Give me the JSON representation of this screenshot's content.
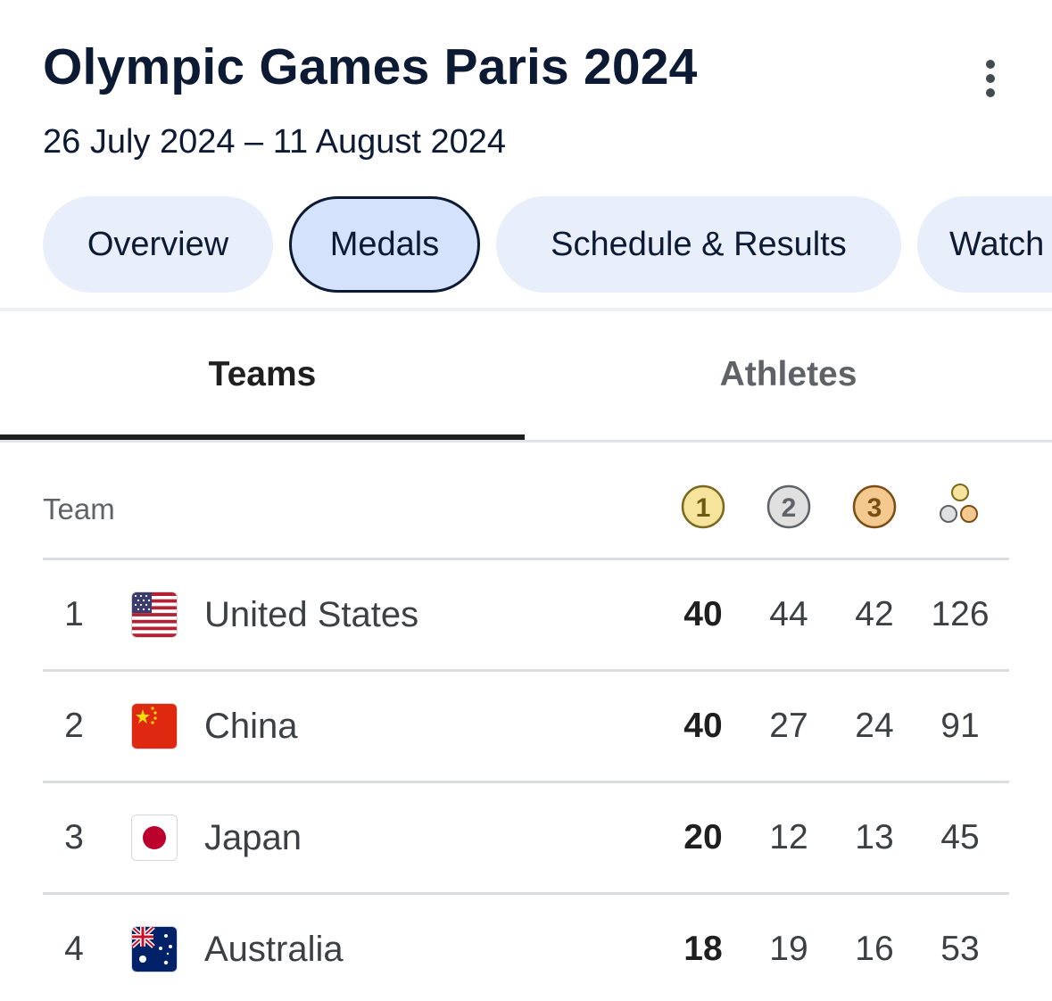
{
  "header": {
    "title": "Olympic Games Paris 2024",
    "dates": "26 July 2024 – 11 August 2024"
  },
  "chips": [
    {
      "label": "Overview",
      "active": false
    },
    {
      "label": "Medals",
      "active": true
    },
    {
      "label": "Schedule & Results",
      "active": false
    },
    {
      "label": "Watch",
      "active": false
    }
  ],
  "tabs": {
    "teams": "Teams",
    "athletes": "Athletes"
  },
  "table": {
    "team_header": "Team",
    "medal_headers": {
      "gold": "1",
      "silver": "2",
      "bronze": "3",
      "total_icon": "medal-total-icon"
    },
    "rows": [
      {
        "rank": "1",
        "country": "United States",
        "flag": "us-flag-icon",
        "gold": "40",
        "silver": "44",
        "bronze": "42",
        "total": "126"
      },
      {
        "rank": "2",
        "country": "China",
        "flag": "china-flag-icon",
        "gold": "40",
        "silver": "27",
        "bronze": "24",
        "total": "91"
      },
      {
        "rank": "3",
        "country": "Japan",
        "flag": "japan-flag-icon",
        "gold": "20",
        "silver": "12",
        "bronze": "13",
        "total": "45"
      },
      {
        "rank": "4",
        "country": "Australia",
        "flag": "australia-flag-icon",
        "gold": "18",
        "silver": "19",
        "bronze": "16",
        "total": "53"
      }
    ]
  },
  "colors": {
    "gold_medal": "#f6e39c",
    "silver_medal": "#e0e0e0",
    "bronze_medal": "#f3c98f",
    "chip_bg": "#e8effb",
    "chip_active_bg": "#d4e2fc"
  }
}
